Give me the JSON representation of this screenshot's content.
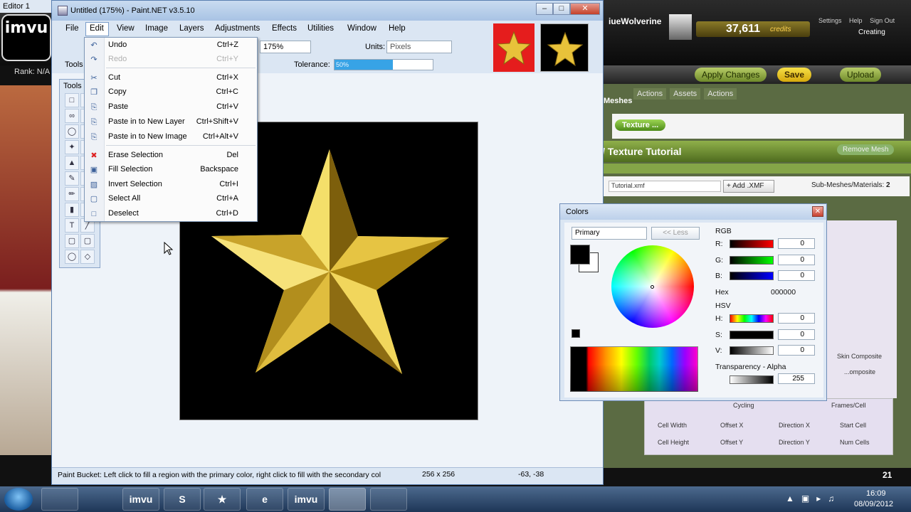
{
  "imvu": {
    "editor_tab": "Editor 1",
    "logo": "imvu",
    "rank": "Rank: N/A",
    "username": "iueWolverine",
    "credits": "37,611",
    "credits_label": "credits",
    "links": [
      "Settings",
      "Help",
      "Sign Out"
    ],
    "mode": "Creating",
    "actions": [
      "Apply Changes",
      "Save",
      "Upload"
    ],
    "panel_tabs": [
      "Actions",
      "Assets",
      "Actions"
    ],
    "meshes_label": "Meshes",
    "texture_pill": "Texture ...",
    "tutorial_title": "/ Texture Tutorial",
    "remove_mesh": "Remove Mesh",
    "xmf_file": "Tutorial.xmf",
    "add_xmf": "Add .XMF",
    "submesh_label": "Sub-Meshes/Materials:",
    "submesh_count": "2",
    "skin_composite": "Skin Composite",
    "composite": "...omposite",
    "cycling": "Cycling",
    "fields": [
      "Frames/Cell",
      "Cell Width",
      "Offset X",
      "Direction X",
      "Start Cell",
      "Cell Height",
      "Offset Y",
      "Direction Y",
      "Num Cells"
    ],
    "notification_count": "21"
  },
  "paint": {
    "title": "Untitled (175%) - Paint.NET v3.5.10",
    "menus": [
      "File",
      "Edit",
      "View",
      "Image",
      "Layers",
      "Adjustments",
      "Effects",
      "Utilities",
      "Window",
      "Help"
    ],
    "zoom": "175%",
    "units_label": "Units:",
    "units_value": "Pixels",
    "tolerance_label": "Tolerance:",
    "tolerance_value": "50%",
    "tools_label": "Tools",
    "tools_title": "Tools",
    "status_text": "Paint Bucket: Left click to fill a region with the primary color, right click to fill with the secondary col",
    "status_size": "256 x 256",
    "status_coords": "-63, -38",
    "edit_menu": [
      {
        "label": "Undo",
        "shortcut": "Ctrl+Z",
        "icon": "undo-icon",
        "disabled": false
      },
      {
        "label": "Redo",
        "shortcut": "Ctrl+Y",
        "icon": "redo-icon",
        "disabled": true
      },
      {
        "label": "Cut",
        "shortcut": "Ctrl+X",
        "icon": "cut-icon",
        "disabled": false
      },
      {
        "label": "Copy",
        "shortcut": "Ctrl+C",
        "icon": "copy-icon",
        "disabled": false
      },
      {
        "label": "Paste",
        "shortcut": "Ctrl+V",
        "icon": "paste-icon",
        "disabled": false
      },
      {
        "label": "Paste in to New Layer",
        "shortcut": "Ctrl+Shift+V",
        "icon": "paste-layer-icon",
        "disabled": false
      },
      {
        "label": "Paste in to New Image",
        "shortcut": "Ctrl+Alt+V",
        "icon": "paste-image-icon",
        "disabled": false
      },
      {
        "label": "Erase Selection",
        "shortcut": "Del",
        "icon": "erase-icon",
        "disabled": false
      },
      {
        "label": "Fill Selection",
        "shortcut": "Backspace",
        "icon": "fill-icon",
        "disabled": false
      },
      {
        "label": "Invert Selection",
        "shortcut": "Ctrl+I",
        "icon": "invert-icon",
        "disabled": false
      },
      {
        "label": "Select All",
        "shortcut": "Ctrl+A",
        "icon": "select-all-icon",
        "disabled": false
      },
      {
        "label": "Deselect",
        "shortcut": "Ctrl+D",
        "icon": "deselect-icon",
        "disabled": false
      }
    ]
  },
  "colors": {
    "title": "Colors",
    "mode": "Primary",
    "less_button": "<< Less",
    "rgb_label": "RGB",
    "r_label": "R:",
    "r_value": "0",
    "g_label": "G:",
    "g_value": "0",
    "b_label": "B:",
    "b_value": "0",
    "hex_label": "Hex",
    "hex_value": "000000",
    "hsv_label": "HSV",
    "h_label": "H:",
    "h_value": "0",
    "s_label": "S:",
    "s_value": "0",
    "v_label": "V:",
    "v_value": "0",
    "transparency_label": "Transparency - Alpha",
    "alpha_value": "255",
    "primary_color": "#000000",
    "secondary_color": "#ffffff"
  },
  "taskbar": {
    "apps": [
      "imvu",
      "imvu",
      "skype-icon",
      "users-icon",
      "ie-icon",
      "imvu",
      "paint-icon",
      "folder-icon"
    ],
    "app_labels": [
      "",
      "imvu",
      "S",
      "★",
      "e",
      "imvu",
      "",
      ""
    ],
    "time": "16:09",
    "date": "08/09/2012"
  }
}
